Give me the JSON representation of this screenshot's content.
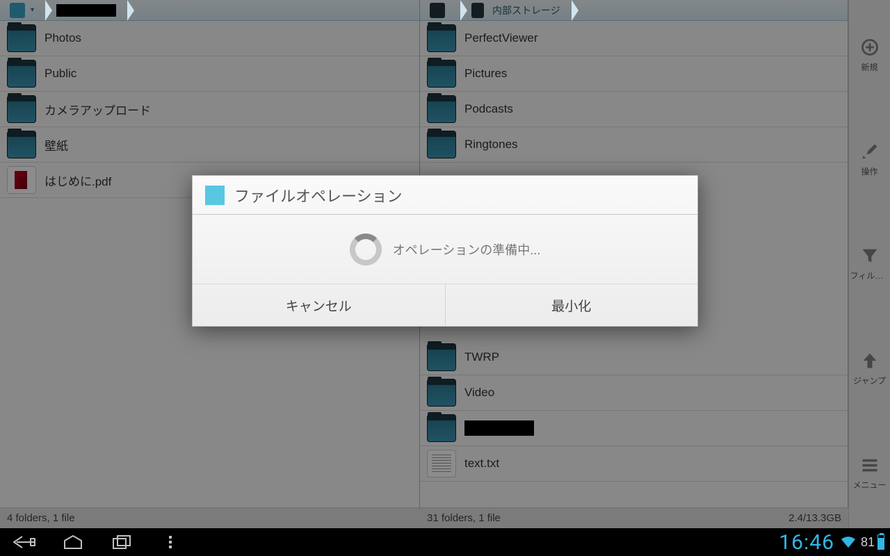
{
  "left_pane": {
    "breadcrumb": {
      "provider_icon": "dropbox",
      "account_redacted": true
    },
    "items": [
      {
        "kind": "folder",
        "label": "Photos"
      },
      {
        "kind": "folder",
        "label": "Public"
      },
      {
        "kind": "folder",
        "label": "カメラアップロード"
      },
      {
        "kind": "folder",
        "label": "壁紙"
      },
      {
        "kind": "pdf",
        "label": "はじめに.pdf"
      }
    ],
    "status": "4 folders, 1 file"
  },
  "right_pane": {
    "breadcrumb": {
      "root_icon": "device",
      "location": "内部ストレージ"
    },
    "items": [
      {
        "kind": "folder",
        "label": "PerfectViewer"
      },
      {
        "kind": "folder",
        "label": "Pictures"
      },
      {
        "kind": "folder",
        "label": "Podcasts"
      },
      {
        "kind": "folder",
        "label": "Ringtones"
      },
      {
        "kind": "folder",
        "label": "TWRP"
      },
      {
        "kind": "folder",
        "label": "Video"
      },
      {
        "kind": "folder",
        "label": "",
        "redacted": true
      },
      {
        "kind": "txt",
        "label": "text.txt"
      }
    ],
    "status_left": "31 folders, 1 file",
    "status_right": "2.4/13.3GB"
  },
  "sidebar": [
    {
      "id": "new",
      "icon": "plus-circle",
      "label": "新規"
    },
    {
      "id": "ops",
      "icon": "tools",
      "label": "操作"
    },
    {
      "id": "filter",
      "icon": "funnel",
      "label": "フィルタ..."
    },
    {
      "id": "jump",
      "icon": "arrow-up",
      "label": "ジャンプ"
    },
    {
      "id": "menu",
      "icon": "menu-lines",
      "label": "メニュー"
    }
  ],
  "dialog": {
    "title": "ファイルオペレーション",
    "body": "オペレーションの準備中...",
    "cancel": "キャンセル",
    "minimize": "最小化"
  },
  "systembar": {
    "clock": "16:46",
    "battery_pct": "81"
  }
}
